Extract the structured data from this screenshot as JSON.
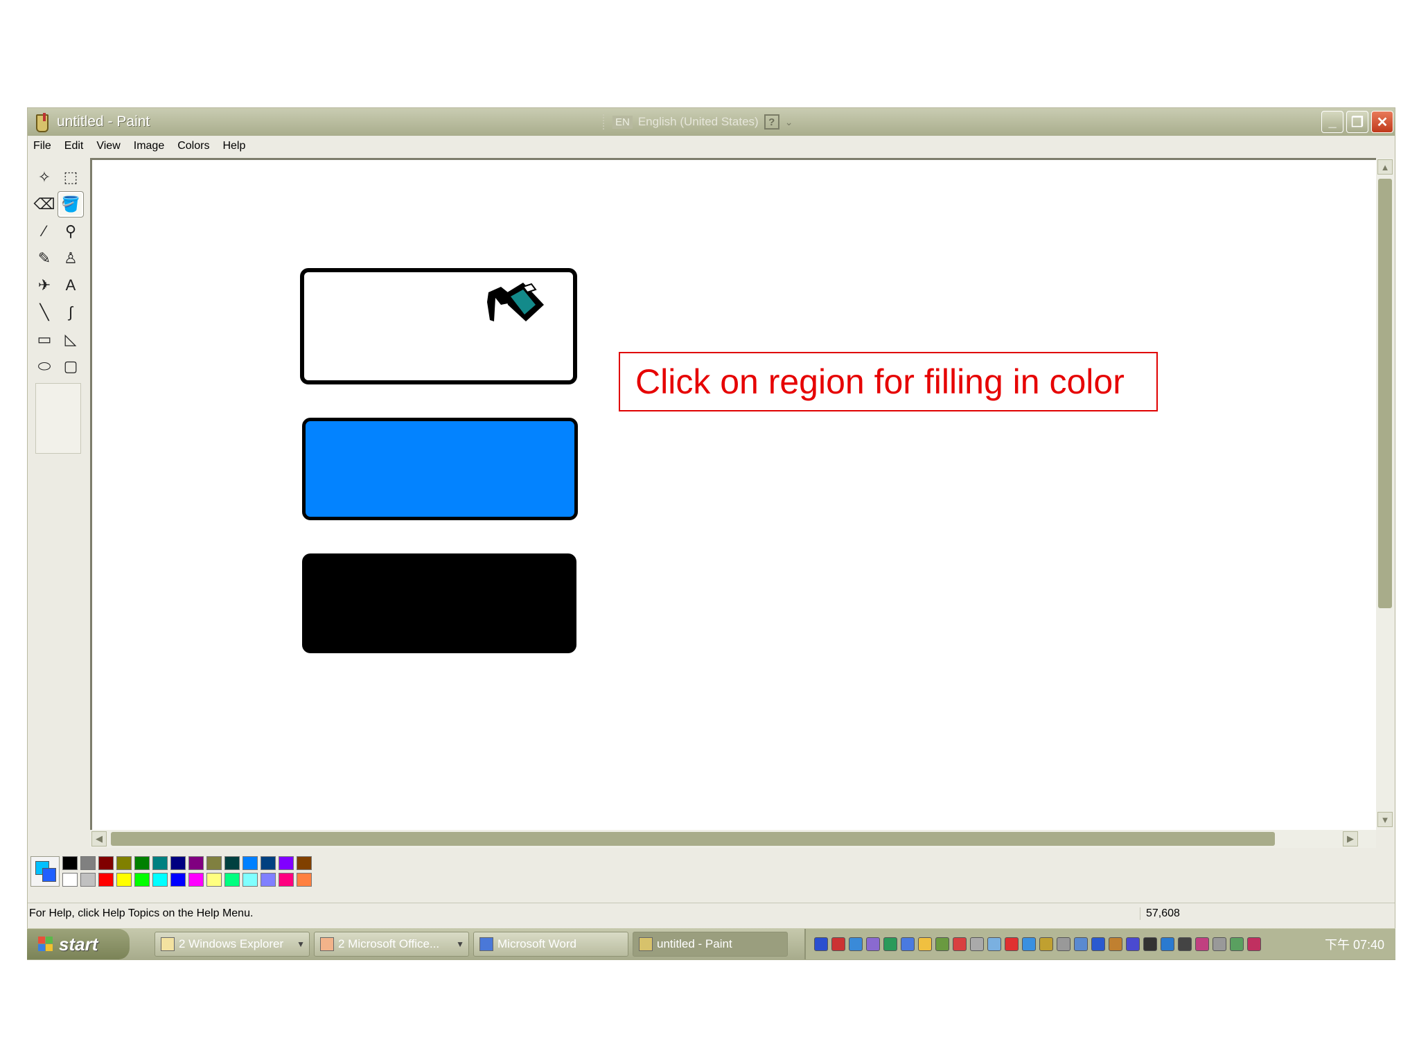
{
  "window": {
    "title": "untitled - Paint",
    "language_bar": {
      "code": "EN",
      "language": "English (United States)",
      "help": "?"
    },
    "buttons": {
      "minimize": "_",
      "restore": "❐",
      "close": "✕"
    }
  },
  "menu": [
    "File",
    "Edit",
    "View",
    "Image",
    "Colors",
    "Help"
  ],
  "tools": [
    {
      "name": "free-form-select-icon",
      "glyph": "✧"
    },
    {
      "name": "rect-select-icon",
      "glyph": "⬚"
    },
    {
      "name": "eraser-icon",
      "glyph": "⌫"
    },
    {
      "name": "fill-bucket-icon",
      "glyph": "🪣"
    },
    {
      "name": "color-picker-icon",
      "glyph": "⁄"
    },
    {
      "name": "magnifier-icon",
      "glyph": "⚲"
    },
    {
      "name": "pencil-icon",
      "glyph": "✎"
    },
    {
      "name": "brush-icon",
      "glyph": "♙"
    },
    {
      "name": "airbrush-icon",
      "glyph": "✈"
    },
    {
      "name": "text-icon",
      "glyph": "A"
    },
    {
      "name": "line-icon",
      "glyph": "╲"
    },
    {
      "name": "curve-icon",
      "glyph": "∫"
    },
    {
      "name": "rectangle-icon",
      "glyph": "▭"
    },
    {
      "name": "polygon-icon",
      "glyph": "◺"
    },
    {
      "name": "ellipse-icon",
      "glyph": "⬭"
    },
    {
      "name": "rounded-rect-icon",
      "glyph": "▢"
    }
  ],
  "active_tool": "fill-bucket-icon",
  "canvas": {
    "callout": "Click on region for filling in color",
    "colors": {
      "blue_fill": "#0383ff",
      "black_fill": "#000000",
      "callout_red": "#e60000"
    }
  },
  "palette": {
    "top_row": [
      "#000000",
      "#808080",
      "#800000",
      "#808000",
      "#008000",
      "#008080",
      "#000080",
      "#800080",
      "#808040",
      "#004040",
      "#0080ff",
      "#004080",
      "#8000ff",
      "#804000"
    ],
    "bottom_row": [
      "#ffffff",
      "#c0c0c0",
      "#ff0000",
      "#ffff00",
      "#00ff00",
      "#00ffff",
      "#0000ff",
      "#ff00ff",
      "#ffff80",
      "#00ff80",
      "#80ffff",
      "#8080ff",
      "#ff0080",
      "#ff8040"
    ]
  },
  "status": {
    "help": "For Help, click Help Topics on the Help Menu.",
    "coords": "57,608"
  },
  "taskbar": {
    "start": "start",
    "tasks": [
      {
        "label": "2 Windows Explorer",
        "dropdown": true,
        "active": false
      },
      {
        "label": "2 Microsoft Office...",
        "dropdown": true,
        "active": false
      },
      {
        "label": "Microsoft Word",
        "dropdown": false,
        "active": false
      },
      {
        "label": "untitled - Paint",
        "dropdown": false,
        "active": true
      }
    ],
    "clock": "下午 07:40"
  }
}
